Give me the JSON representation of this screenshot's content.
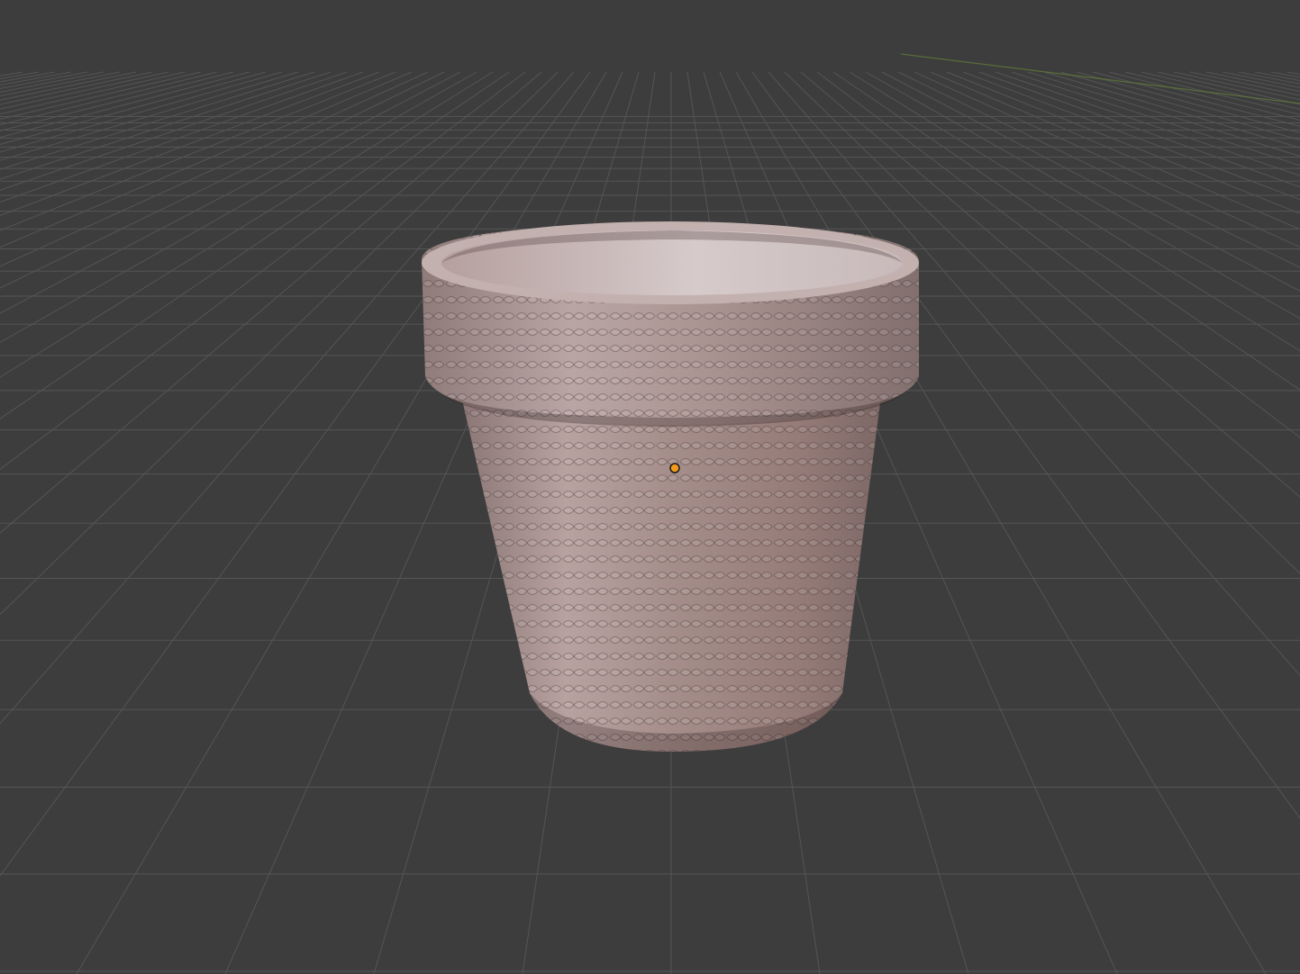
{
  "viewport": {
    "background_color": "#3d3d3d",
    "grid_color": "#555555",
    "y_axis_color": "#5f7a3a"
  },
  "object": {
    "name": "knitted-flower-pot",
    "shading": "solid",
    "base_color": "#a88f8b",
    "inner_color": "#d3c4c4",
    "texture": "knit-braid"
  },
  "origin": {
    "color": "#f29a1c"
  }
}
